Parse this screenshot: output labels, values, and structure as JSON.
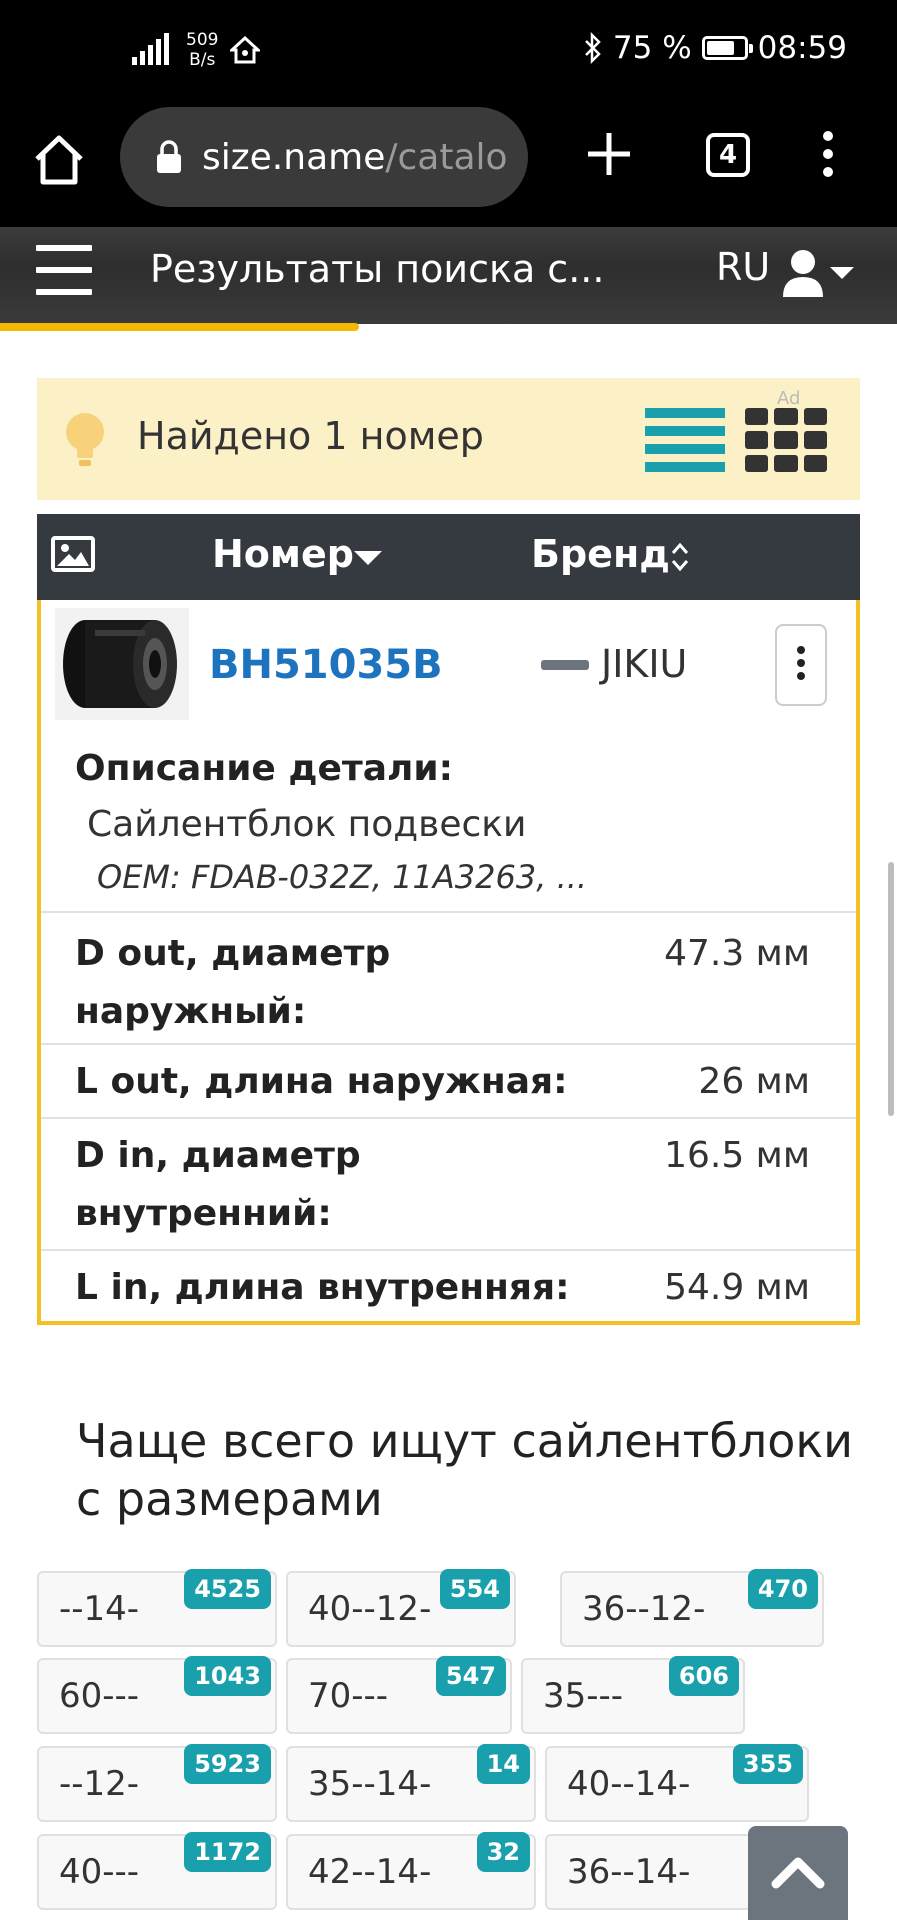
{
  "status_bar": {
    "net_speed_value": "509",
    "net_speed_unit": "B/s",
    "battery": "75 %",
    "time": "08:59"
  },
  "browser": {
    "url_domain": "size.name",
    "url_path": "/catalo",
    "tab_count": "4"
  },
  "site_header": {
    "title": "Результаты поиска с...",
    "language": "RU"
  },
  "found": {
    "text": "Найдено 1 номер",
    "ad": "Ad"
  },
  "table": {
    "col_number": "Номер",
    "col_brand": "Бренд"
  },
  "result": {
    "part_number": "BH51035B",
    "brand": "JIKIU",
    "description_label": "Описание детали:",
    "description": "Сайлентблок подвески",
    "oem": "OEM: FDAB-032Z, 11A3263, ...",
    "specs": [
      {
        "label": "D out, диаметр наружный:",
        "value": "47.3 мм"
      },
      {
        "label": "L out, длина наружная:",
        "value": "26 мм"
      },
      {
        "label": "D in, диаметр внутренний:",
        "value": "16.5 мм"
      },
      {
        "label": "L in, длина внутренняя:",
        "value": "54.9 мм"
      }
    ]
  },
  "popular": {
    "title": "Чаще всего ищут сайлентблоки с размерами",
    "chips": [
      {
        "label": "--14-",
        "count": "4525"
      },
      {
        "label": "40--12-",
        "count": "554"
      },
      {
        "label": "36--12-",
        "count": "470"
      },
      {
        "label": "60---",
        "count": "1043"
      },
      {
        "label": "70---",
        "count": "547"
      },
      {
        "label": "35---",
        "count": "606"
      },
      {
        "label": "--12-",
        "count": "5923"
      },
      {
        "label": "35--14-",
        "count": "14"
      },
      {
        "label": "40--14-",
        "count": "355"
      },
      {
        "label": "40---",
        "count": "1172"
      },
      {
        "label": "42--14-",
        "count": "32"
      },
      {
        "label": "36--14-",
        "count": ""
      }
    ]
  },
  "colors": {
    "accent_teal": "#1aa0ad",
    "card_border": "#f5c023",
    "link_blue": "#1e73be",
    "header_dark": "#343a40",
    "found_bg": "#fcf0c6"
  },
  "icons": {
    "home": "home-icon",
    "lock": "lock-icon",
    "plus": "plus-icon",
    "menu": "kebab-menu-icon",
    "bulb": "lightbulb-icon",
    "image": "image-icon",
    "user": "user-icon",
    "scroll_top": "chevron-up-icon"
  }
}
